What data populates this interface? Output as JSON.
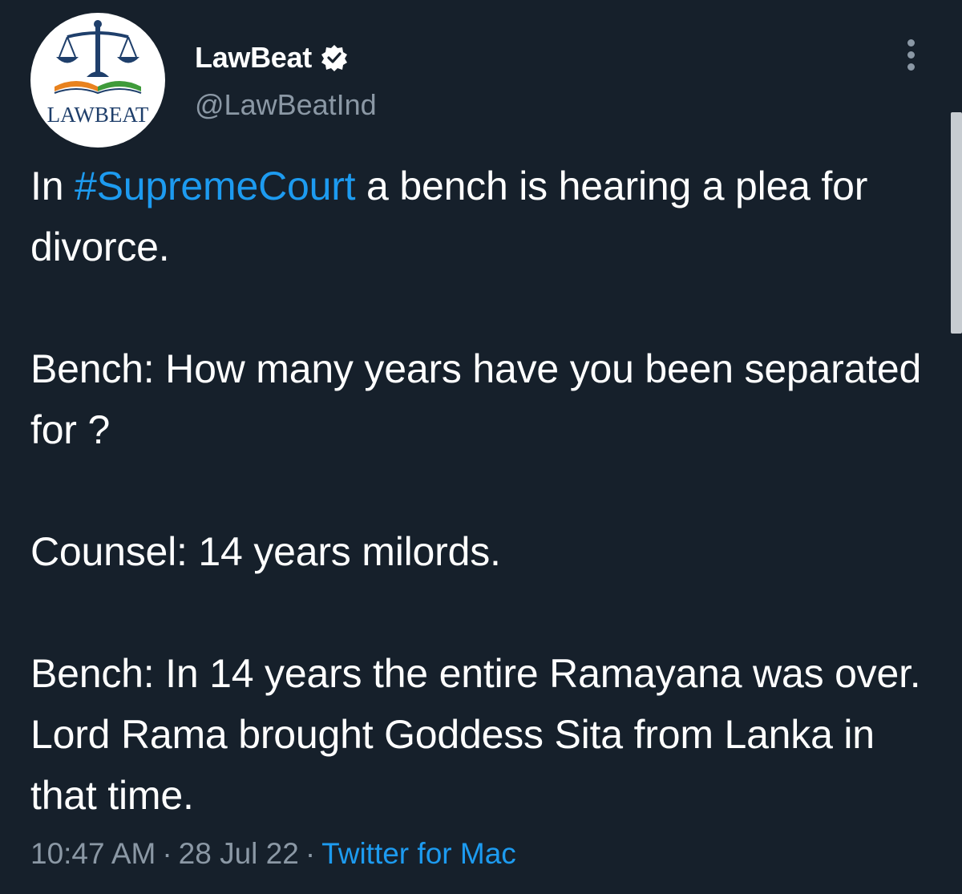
{
  "author": {
    "display_name": "LawBeat",
    "handle": "@LawBeatInd",
    "avatar_text": "LAWBEAT",
    "avatar_icon": "scales-of-justice-icon",
    "verified_icon": "verified-badge-icon"
  },
  "tweet": {
    "line1_prefix": "In ",
    "hashtag": "#SupremeCourt",
    "line1_suffix": " a bench is hearing a plea for divorce.",
    "paragraph2": "Bench: How many years have you been separated for ?",
    "paragraph3": "Counsel: 14 years milords.",
    "paragraph4": "Bench: In 14 years the entire Ramayana was over. Lord Rama brought Goddess Sita from Lanka in that time."
  },
  "meta": {
    "time": "10:47 AM",
    "separator": "·",
    "date": "28 Jul 22",
    "source": "Twitter for Mac"
  },
  "colors": {
    "background": "#16202b",
    "text": "#ffffff",
    "secondary": "#8b98a5",
    "accent": "#1d9bf0"
  }
}
